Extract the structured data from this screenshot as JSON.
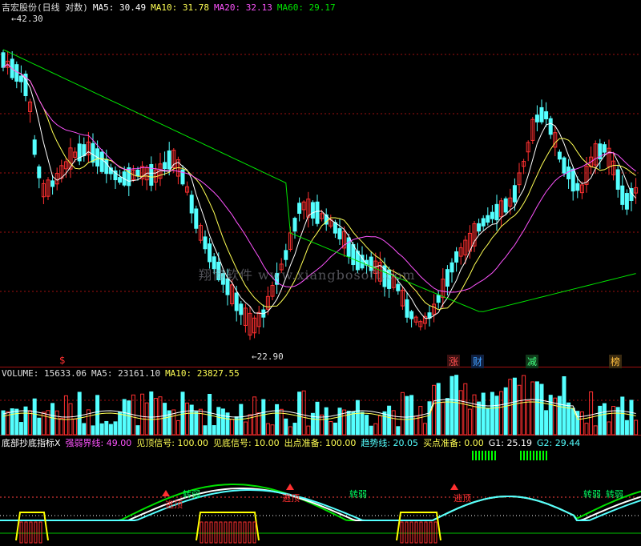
{
  "price_legend": {
    "title": "吉宏股份(日线 对数)",
    "ma5": "MA5: 30.49",
    "ma10": "MA10: 31.78",
    "ma20": "MA20: 32.13",
    "ma60": "MA60: 29.17"
  },
  "price_labels": {
    "high": "42.30",
    "low": "22.90"
  },
  "watermark": "翔博软件 www.xiangbosoft.com",
  "event_badges": [
    {
      "text": "$",
      "color": "#ff3030"
    },
    {
      "text": "涨",
      "color": "#ff5050"
    },
    {
      "text": "财",
      "color": "#40a0ff"
    },
    {
      "text": "减",
      "color": "#40ff80"
    },
    {
      "text": "榜",
      "color": "#ffc040"
    }
  ],
  "volume_legend": {
    "volume": "VOLUME: 15633.06",
    "ma5": "MA5: 23161.10",
    "ma10": "MA10: 23827.55"
  },
  "indicator_legend": {
    "name": "底部抄底指标X",
    "strong_weak": "强弱界线: 49.00",
    "top_signal": "见顶信号: 100.00",
    "bottom_signal": "见底信号: 10.00",
    "exit_prep": "出点准备: 100.00",
    "trend": "趋势线: 20.05",
    "buy_prep": "买点准备: 0.00",
    "g1": "G1: 25.19",
    "g2": "G2: 29.44"
  },
  "indicator_labels": {
    "weakening": "转弱",
    "escape": "逃顶"
  },
  "colors": {
    "bg": "#000000",
    "up": "#ff3030",
    "down": "#54ffff",
    "ma5": "#ffffff",
    "ma10": "#ffff54",
    "ma20": "#ff54ff",
    "ma60": "#00e600",
    "grid": "#a01010"
  },
  "icons": [
    "exit-marker-icon"
  ]
}
